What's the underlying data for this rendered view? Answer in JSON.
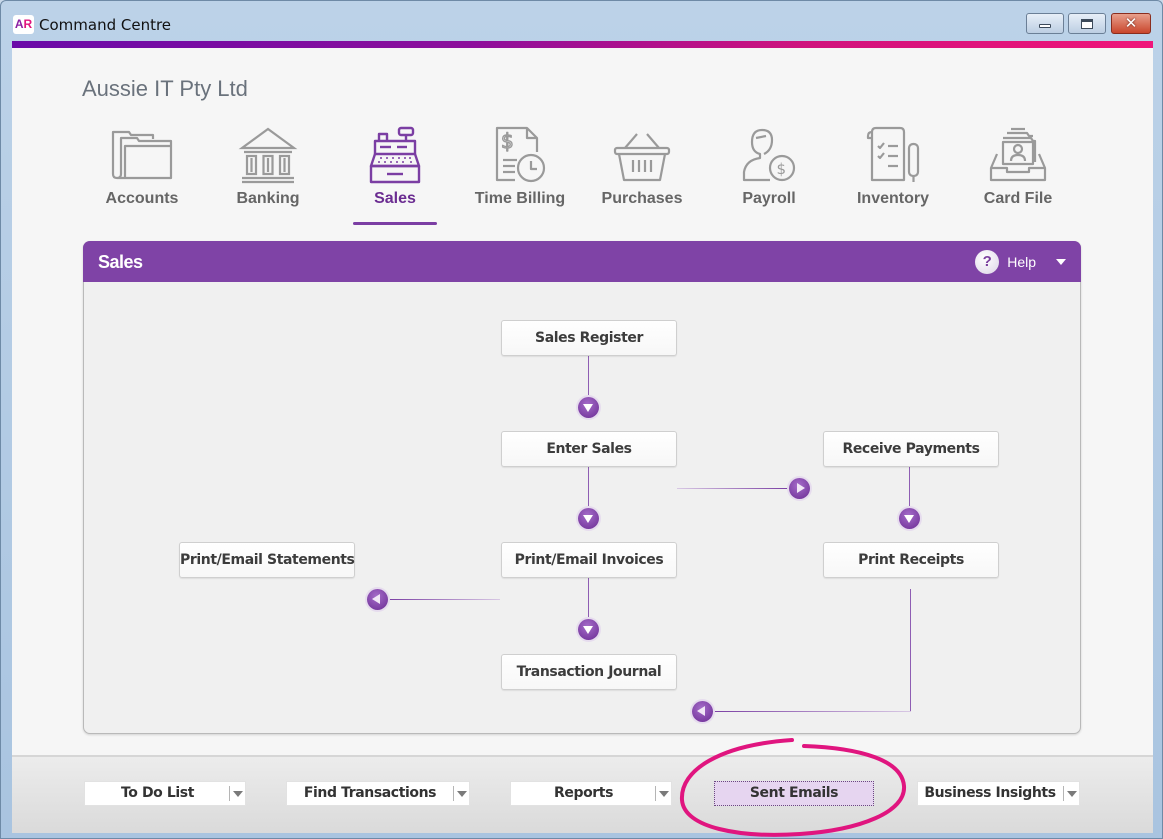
{
  "window": {
    "app_logo": {
      "a": "A",
      "r": "R"
    },
    "title": "Command Centre",
    "buttons": {
      "minimize": "minimize",
      "maximize": "maximize",
      "close": "✕"
    }
  },
  "company_name": "Aussie IT Pty Ltd",
  "nav": {
    "active": "Sales",
    "items": [
      {
        "label": "Accounts",
        "icon": "folder-icon"
      },
      {
        "label": "Banking",
        "icon": "bank-icon"
      },
      {
        "label": "Sales",
        "icon": "cash-register-icon"
      },
      {
        "label": "Time Billing",
        "icon": "invoice-clock-icon"
      },
      {
        "label": "Purchases",
        "icon": "basket-icon"
      },
      {
        "label": "Payroll",
        "icon": "person-dollar-icon"
      },
      {
        "label": "Inventory",
        "icon": "clipboard-pen-icon"
      },
      {
        "label": "Card File",
        "icon": "card-file-icon"
      }
    ]
  },
  "panel": {
    "title": "Sales",
    "help_label": "Help",
    "help_icon_glyph": "?"
  },
  "flow": {
    "sales_register": "Sales Register",
    "enter_sales": "Enter Sales",
    "receive_payments": "Receive Payments",
    "print_email_statements": "Print/Email Statements",
    "print_email_invoices": "Print/Email Invoices",
    "print_receipts": "Print Receipts",
    "transaction_journal": "Transaction Journal"
  },
  "bottom_bar": {
    "to_do_list": "To Do List",
    "find_transactions": "Find Transactions",
    "reports": "Reports",
    "sent_emails": "Sent Emails",
    "business_insights": "Business Insights"
  },
  "colors": {
    "accent_purple": "#7f43a6",
    "annotation_pink": "#e0157f",
    "active_nav": "#6b2c91"
  }
}
